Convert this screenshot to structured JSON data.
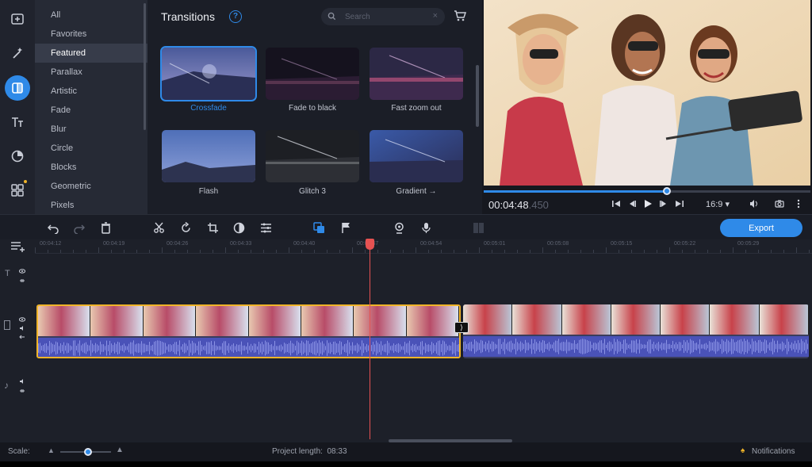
{
  "sidebar": {
    "icons": [
      {
        "name": "import-icon"
      },
      {
        "name": "magic-wand-icon"
      },
      {
        "name": "transitions-icon",
        "active": true
      },
      {
        "name": "titles-icon",
        "label": "Tт"
      },
      {
        "name": "stickers-icon"
      },
      {
        "name": "more-tools-icon",
        "dot": true
      }
    ]
  },
  "categories": {
    "items": [
      "All",
      "Favorites",
      "Featured",
      "Parallax",
      "Artistic",
      "Fade",
      "Blur",
      "Circle",
      "Blocks",
      "Geometric",
      "Pixels"
    ],
    "selected": "Featured"
  },
  "transitions": {
    "title": "Transitions",
    "help": "?",
    "search_placeholder": "Search",
    "search_clear": "×",
    "items": [
      {
        "label": "Crossfade",
        "selected": true
      },
      {
        "label": "Fade to black"
      },
      {
        "label": "Fast zoom out"
      },
      {
        "label": "Flash"
      },
      {
        "label": "Glitch 3"
      },
      {
        "label": "Gradient →"
      }
    ]
  },
  "player": {
    "timecode_main": "00:04:48",
    "timecode_ms": ".450",
    "position_fraction": 0.56,
    "aspect_ratio": "16:9 ▾"
  },
  "toolbar": {
    "export_label": "Export"
  },
  "timeline": {
    "ruler_labels": [
      "00:04:12",
      "00:04:19",
      "00:04:26",
      "00:04:33",
      "00:04:40",
      "00:04:47",
      "00:04:54",
      "00:05:01",
      "00:05:08",
      "00:05:15",
      "00:05:22",
      "00:05:29"
    ],
    "transition_marker": "⟩"
  },
  "status": {
    "scale_label": "Scale:",
    "project_length_label": "Project length:",
    "project_length_value": "08:33",
    "notifications_label": "Notifications"
  },
  "colors": {
    "accent": "#2f8ae8",
    "selection": "#f0b429",
    "playhead": "#e65252",
    "audio_wave": "#4a52b8"
  }
}
